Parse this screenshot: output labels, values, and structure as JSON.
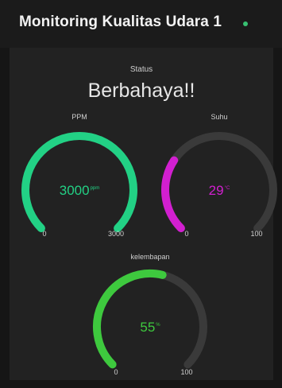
{
  "app": {
    "title": "Monitoring Kualitas Udara 1"
  },
  "colors": {
    "track": "#3a3a3a",
    "status_dot": "#38c172"
  },
  "status": {
    "label": "Status",
    "value": "Berbahaya!!"
  },
  "gauges": {
    "ppm": {
      "label": "PPM",
      "value": "3000",
      "unit": "ppm",
      "min": "0",
      "max": "3000",
      "fraction": 1.0,
      "color": "#22d185"
    },
    "suhu": {
      "label": "Suhu",
      "value": "29",
      "unit": "°C",
      "min": "0",
      "max": "100",
      "fraction": 0.29,
      "color": "#d21fd0"
    },
    "kelembapan": {
      "label": "kelembapan",
      "value": "55",
      "unit": "%",
      "min": "0",
      "max": "100",
      "fraction": 0.55,
      "color": "#3ec93e"
    }
  }
}
